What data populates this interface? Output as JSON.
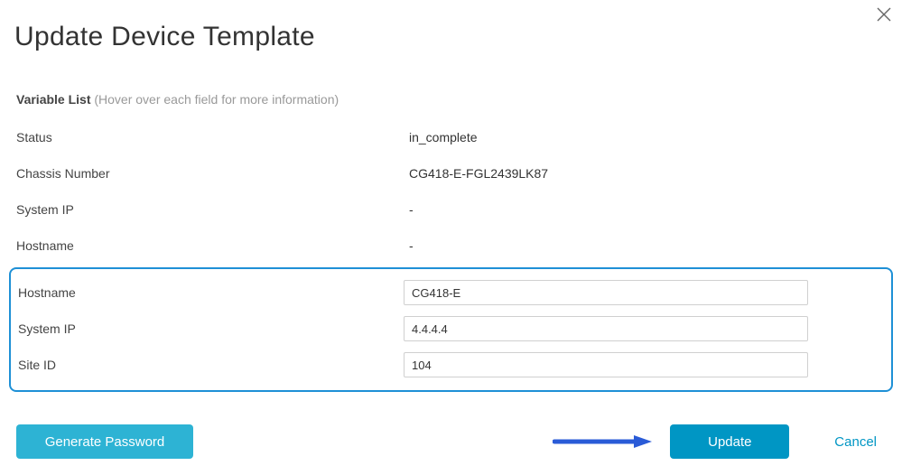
{
  "dialog": {
    "title": "Update Device Template"
  },
  "section": {
    "heading": "Variable List",
    "hint": "(Hover over each field for more information)"
  },
  "readonly": {
    "status": {
      "label": "Status",
      "value": "in_complete"
    },
    "chassis": {
      "label": "Chassis Number",
      "value": "CG418-E-FGL2439LK87"
    },
    "systemip": {
      "label": "System IP",
      "value": "-"
    },
    "hostname": {
      "label": "Hostname",
      "value": "-"
    }
  },
  "editable": {
    "hostname": {
      "label": "Hostname",
      "value": "CG418-E"
    },
    "systemip": {
      "label": "System IP",
      "value": "4.4.4.4"
    },
    "siteid": {
      "label": "Site ID",
      "value": "104"
    }
  },
  "actions": {
    "generate": "Generate Password",
    "update": "Update",
    "cancel": "Cancel"
  }
}
